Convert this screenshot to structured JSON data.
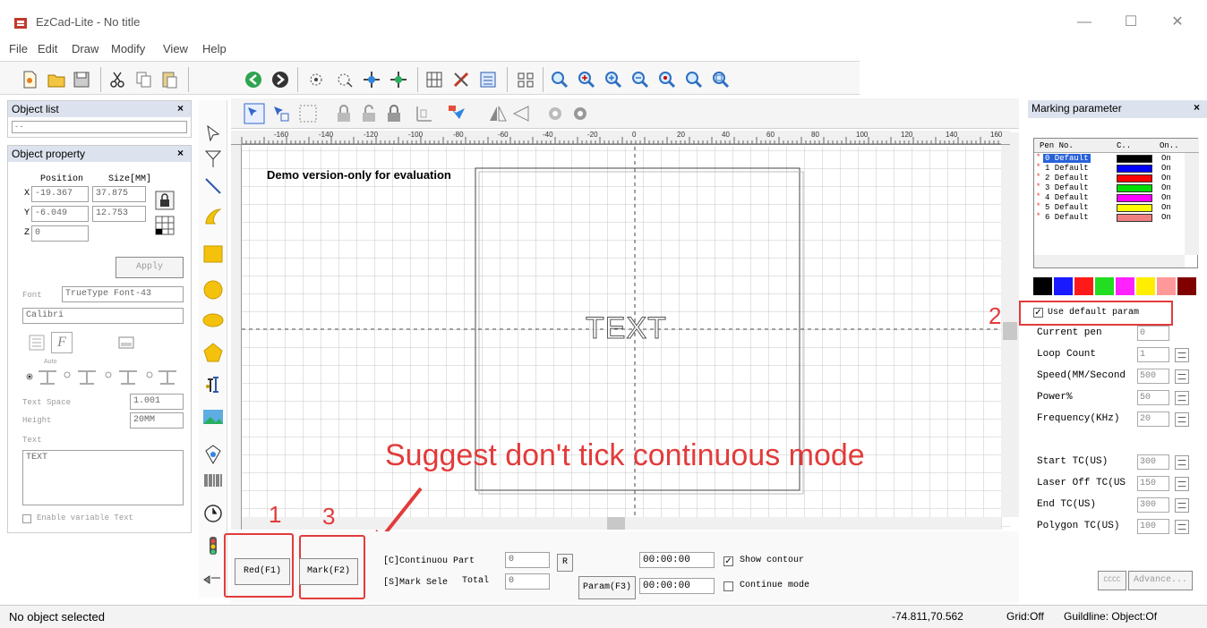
{
  "window": {
    "title": "EzCad-Lite  - No title",
    "min_label": "—",
    "max_label": "☐",
    "close_label": "✕"
  },
  "menu": [
    "File",
    "Edit",
    "Draw",
    "Modify",
    "View",
    "Help"
  ],
  "toolbar_icons": [
    "new-icon",
    "open-icon",
    "save-icon",
    "cut-icon",
    "copy-icon",
    "paste-icon",
    "undo-icon",
    "redo-icon",
    "select-node-icon",
    "node-edit-icon",
    "group-icon",
    "ungroup-icon",
    "hatch-icon",
    "edit-icon",
    "property-icon",
    "array-icon",
    "zoom-in-icon",
    "zoom-plus-icon",
    "zoom-select-icon",
    "zoom-out-icon",
    "zoom-all-icon",
    "zoom-fit-icon",
    "zoom-work-icon"
  ],
  "object_list": {
    "title": "Object list",
    "dropdown": "-  -"
  },
  "object_property": {
    "title": "Object property",
    "position_label": "Position",
    "size_label": "Size[MM]",
    "x_label": "X",
    "y_label": "Y",
    "z_label": "Z",
    "x_pos": "-19.367",
    "x_size": "37.875",
    "y_pos": "-6.049",
    "y_size": "12.753",
    "z_pos": "0",
    "apply_label": "Apply",
    "font_label": "Font",
    "font_type": "TrueType Font-43",
    "font_name": "Calibri",
    "text_space_label": "Text Space",
    "text_space": "1.001",
    "height_label": "Height",
    "height": "20MM",
    "text_label": "Text",
    "text_value": "TEXT",
    "variable_text_label": "Enable variable Text",
    "auto_label": "Auto"
  },
  "canvas": {
    "demo_text": "Demo version-only for evaluation",
    "object_text": "TEXT",
    "ruler_ticks": [
      "-160",
      "-140",
      "-120",
      "-100",
      "-80",
      "-60",
      "-40",
      "-20",
      "0",
      "20",
      "40",
      "60",
      "80",
      "100",
      "120",
      "140",
      "160"
    ]
  },
  "annotation": {
    "message": "Suggest don't tick continuous mode",
    "n1": "1",
    "n2": "2",
    "n3": "3"
  },
  "bottom": {
    "red_label": "Red(F1)",
    "mark_label": "Mark(F2)",
    "continuous_part": "[C]Continuou Part",
    "mark_select": "[S]Mark Sele",
    "part_value": "0",
    "total_label": "Total",
    "total_value": "0",
    "r_label": "R",
    "param_label": "Param(F3)",
    "time1": "00:00:00",
    "time2": "00:00:00",
    "show_contour": "Show contour",
    "continue_mode": "Continue mode"
  },
  "marking": {
    "title": "Marking parameter",
    "col_pen": "Pen No.",
    "col_c": "C..",
    "col_on": "On..",
    "pens": [
      {
        "name": "0 Default",
        "color": "#000000",
        "on": "On"
      },
      {
        "name": "1 Default",
        "color": "#0000ff",
        "on": "On"
      },
      {
        "name": "2 Default",
        "color": "#ff0000",
        "on": "On"
      },
      {
        "name": "3 Default",
        "color": "#00dd00",
        "on": "On"
      },
      {
        "name": "4 Default",
        "color": "#ff00ff",
        "on": "On"
      },
      {
        "name": "5 Default",
        "color": "#ffff00",
        "on": "On"
      },
      {
        "name": "6 Default",
        "color": "#f08080",
        "on": "On"
      }
    ],
    "palette": [
      "#000000",
      "#1a1aff",
      "#ff1a1a",
      "#22dd22",
      "#ff22ff",
      "#ffee00",
      "#ff9999",
      "#800000"
    ],
    "use_default": "Use default param",
    "params": [
      {
        "label": "Current pen",
        "value": "0"
      },
      {
        "label": "Loop Count",
        "value": "1"
      },
      {
        "label": "Speed(MM/Second",
        "value": "500"
      },
      {
        "label": "Power%",
        "value": "50"
      },
      {
        "label": "Frequency(KHz)",
        "value": "20"
      }
    ],
    "tc_params": [
      {
        "label": "Start TC(US)",
        "value": "300"
      },
      {
        "label": "Laser Off TC(US",
        "value": "150"
      },
      {
        "label": "End TC(US)",
        "value": "300"
      },
      {
        "label": "Polygon TC(US)",
        "value": "100"
      }
    ],
    "advance_label": "Advance...",
    "extra_btn": "CCCC"
  },
  "status": {
    "left": "No object selected",
    "coords": "-74.811,70.562",
    "grid": "Grid:Off",
    "guideline": "Guildline: Object:Of"
  }
}
